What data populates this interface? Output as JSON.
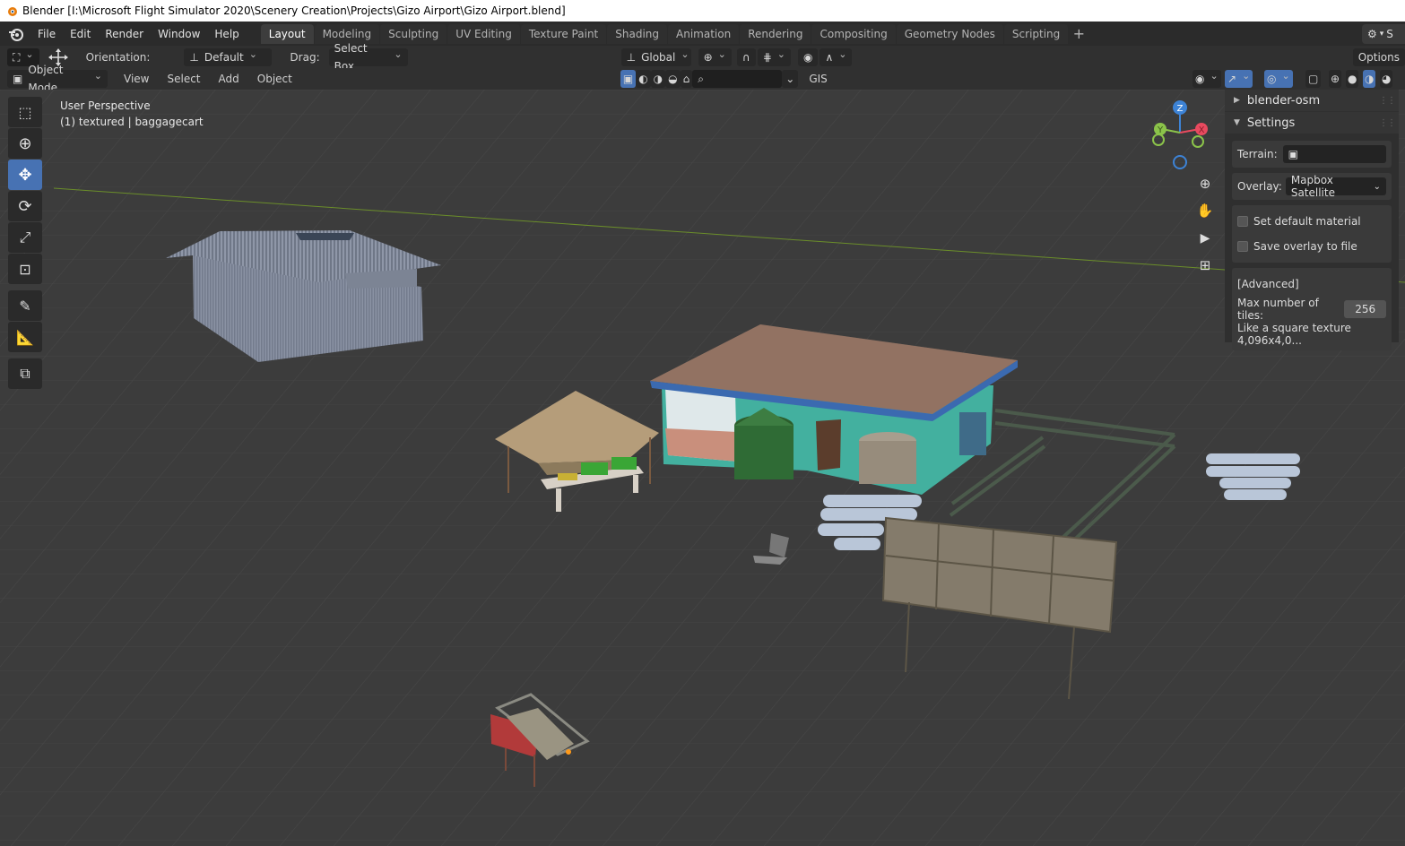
{
  "window": {
    "title": "Blender [I:\\Microsoft Flight Simulator 2020\\Scenery Creation\\Projects\\Gizo Airport\\Gizo Airport.blend]"
  },
  "menubar": {
    "items": [
      "File",
      "Edit",
      "Render",
      "Window",
      "Help"
    ],
    "workspaces": [
      "Layout",
      "Modeling",
      "Sculpting",
      "UV Editing",
      "Texture Paint",
      "Shading",
      "Animation",
      "Rendering",
      "Compositing",
      "Geometry Nodes",
      "Scripting"
    ],
    "active_workspace": "Layout",
    "scene_initial": "S"
  },
  "toolheader": {
    "orientation_label": "Orientation:",
    "orientation_value": "Default",
    "drag_label": "Drag:",
    "drag_value": "Select Box",
    "transform_orientation": "Global",
    "options_label": "Options"
  },
  "viewport_header": {
    "mode": "Object Mode",
    "menus": [
      "View",
      "Select",
      "Add",
      "Object"
    ],
    "gis_label": "GIS"
  },
  "viewport": {
    "perspective_label": "User Perspective",
    "collection_label": "(1) textured | baggagecart"
  },
  "gizmo": {
    "x": "X",
    "y": "Y",
    "z": "Z",
    "colors": {
      "x": "#e84a5f",
      "y": "#8bc34a",
      "z": "#3d83d6"
    }
  },
  "npanel": {
    "section_osm": "blender-osm",
    "section_settings": "Settings",
    "terrain_label": "Terrain:",
    "overlay_label": "Overlay:",
    "overlay_value": "Mapbox Satellite",
    "set_default_material": "Set default material",
    "save_overlay": "Save overlay to file",
    "advanced_label": "[Advanced]",
    "max_tiles_label": "Max number of tiles:",
    "max_tiles_value": "256",
    "texture_note": "Like a square texture 4,096x4,0..."
  },
  "colors": {
    "accent": "#4772b3",
    "viewport_bg": "#3c3c3c",
    "header_bg": "#303030"
  }
}
